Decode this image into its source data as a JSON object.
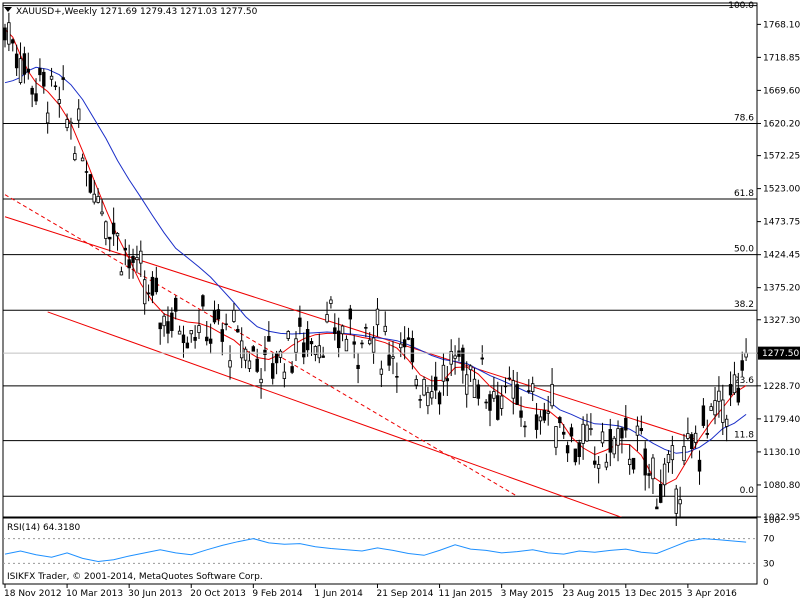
{
  "window": {
    "header": "XAUUSD+,Weekly  1271.69 1279.43 1271.03 1277.50",
    "footer": "ISIKFX Trader, © 2001-2014, MetaQuotes Software Corp.",
    "current_price_label": "1277.50"
  },
  "colors": {
    "candles": "#000000",
    "ma_fast": "#ee0000",
    "ma_slow": "#1a2ec8",
    "channel": "#ee0000",
    "fib_lines": "#000000",
    "rsi": "#1e90ff",
    "grid_border": "#000000"
  },
  "chart_data": [
    {
      "type": "candlestick",
      "title": "",
      "symbol": "XAUUSD+",
      "timeframe": "Weekly",
      "ohlc_last": {
        "open": 1271.69,
        "high": 1279.43,
        "low": 1271.03,
        "close": 1277.5
      },
      "ylim": [
        1032.95,
        1800
      ],
      "y_ticks": [
        1768.1,
        1718.85,
        1669.6,
        1620.2,
        1572.25,
        1523.0,
        1473.75,
        1424.45,
        1375.2,
        1327.3,
        1277.5,
        1228.7,
        1179.4,
        1130.1,
        1080.8,
        1032.95
      ],
      "y_tick_labels": [
        "1768.10",
        "1718.85",
        "1669.60",
        "1620.20",
        "1572.25",
        "1523.00",
        "1473.75",
        "1424.45",
        "1375.20",
        "1327.30",
        "1277.50",
        "1228.70",
        "1179.40",
        "1130.10",
        "1080.80",
        "1032.95"
      ],
      "x_tick_labels": [
        "18 Nov 2012",
        "10 Mar 2013",
        "30 Jun 2013",
        "20 Oct 2013",
        "9 Feb 2014",
        "1 Jun 2014",
        "21 Sep 2014",
        "11 Jan 2015",
        "3 May 2015",
        "23 Aug 2015",
        "13 Dec 2015",
        "3 Apr 2016"
      ],
      "fibonacci_levels": [
        {
          "label": "100.0",
          "price": 1796
        },
        {
          "label": "78.6",
          "price": 1620.2
        },
        {
          "label": "61.8",
          "price": 1507.5
        },
        {
          "label": "50.0",
          "price": 1424.45
        },
        {
          "label": "38.2",
          "price": 1341.5
        },
        {
          "label": "23.6",
          "price": 1228.7
        },
        {
          "label": "11.8",
          "price": 1147
        },
        {
          "label": "0.0",
          "price": 1064
        }
      ],
      "channel_lines": [
        {
          "style": "solid",
          "start": [
            "18 Nov 2012",
            1481
          ],
          "end": [
            "17 Apr 2016",
            1149
          ]
        },
        {
          "style": "solid",
          "start": [
            "3 Feb 2013",
            1339
          ],
          "end": [
            "3 Jan 2016",
            1024
          ]
        },
        {
          "style": "dashed",
          "start": [
            "18 Nov 2012",
            1514
          ],
          "end": [
            "31 May 2015",
            1064
          ]
        }
      ],
      "moving_averages": [
        {
          "color": "ma_fast",
          "points": [
            [
              0,
              1761
            ],
            [
              2,
              1749
            ],
            [
              4,
              1722
            ],
            [
              6,
              1698
            ],
            [
              8,
              1681
            ],
            [
              11,
              1668
            ],
            [
              14,
              1648
            ],
            [
              17,
              1620
            ],
            [
              20,
              1579
            ],
            [
              23,
              1535
            ],
            [
              26,
              1492
            ],
            [
              29,
              1452
            ],
            [
              32,
              1418
            ],
            [
              35,
              1381
            ],
            [
              38,
              1355
            ],
            [
              41,
              1336
            ],
            [
              44,
              1329
            ],
            [
              47,
              1324
            ],
            [
              50,
              1322
            ],
            [
              53,
              1316
            ],
            [
              56,
              1306
            ],
            [
              59,
              1297
            ],
            [
              62,
              1282
            ],
            [
              65,
              1271
            ],
            [
              68,
              1268
            ],
            [
              71,
              1276
            ],
            [
              74,
              1289
            ],
            [
              77,
              1299
            ],
            [
              80,
              1305
            ],
            [
              83,
              1307
            ],
            [
              86,
              1307
            ],
            [
              89,
              1305
            ],
            [
              92,
              1301
            ],
            [
              95,
              1298
            ],
            [
              98,
              1293
            ],
            [
              101,
              1285
            ],
            [
              104,
              1267
            ],
            [
              107,
              1245
            ],
            [
              110,
              1236
            ],
            [
              113,
              1237
            ],
            [
              116,
              1256
            ],
            [
              119,
              1257
            ],
            [
              122,
              1246
            ],
            [
              125,
              1228
            ],
            [
              128,
              1216
            ],
            [
              131,
              1203
            ],
            [
              134,
              1197
            ],
            [
              137,
              1194
            ],
            [
              140,
              1192
            ],
            [
              143,
              1178
            ],
            [
              146,
              1152
            ],
            [
              149,
              1136
            ],
            [
              152,
              1126
            ],
            [
              155,
              1133
            ],
            [
              158,
              1142
            ],
            [
              161,
              1141
            ],
            [
              164,
              1125
            ],
            [
              167,
              1093
            ],
            [
              170,
              1081
            ],
            [
              173,
              1090
            ],
            [
              176,
              1119
            ],
            [
              179,
              1150
            ],
            [
              182,
              1175
            ],
            [
              185,
              1196
            ],
            [
              188,
              1218
            ],
            [
              191,
              1229
            ]
          ]
        },
        {
          "color": "ma_slow",
          "points": [
            [
              0,
              1681
            ],
            [
              2,
              1684
            ],
            [
              4,
              1689
            ],
            [
              6,
              1699
            ],
            [
              8,
              1704
            ],
            [
              11,
              1701
            ],
            [
              14,
              1693
            ],
            [
              17,
              1678
            ],
            [
              20,
              1656
            ],
            [
              23,
              1627
            ],
            [
              26,
              1598
            ],
            [
              29,
              1565
            ],
            [
              32,
              1536
            ],
            [
              35,
              1510
            ],
            [
              38,
              1483
            ],
            [
              41,
              1457
            ],
            [
              44,
              1434
            ],
            [
              47,
              1420
            ],
            [
              50,
              1406
            ],
            [
              53,
              1391
            ],
            [
              56,
              1372
            ],
            [
              59,
              1353
            ],
            [
              62,
              1332
            ],
            [
              65,
              1317
            ],
            [
              68,
              1310
            ],
            [
              71,
              1307
            ],
            [
              74,
              1306
            ],
            [
              77,
              1307
            ],
            [
              80,
              1308
            ],
            [
              83,
              1309
            ],
            [
              86,
              1308
            ],
            [
              89,
              1306
            ],
            [
              92,
              1304
            ],
            [
              95,
              1301
            ],
            [
              98,
              1299
            ],
            [
              101,
              1296
            ],
            [
              104,
              1290
            ],
            [
              107,
              1282
            ],
            [
              110,
              1274
            ],
            [
              113,
              1268
            ],
            [
              116,
              1265
            ],
            [
              119,
              1262
            ],
            [
              122,
              1253
            ],
            [
              125,
              1244
            ],
            [
              128,
              1237
            ],
            [
              131,
              1229
            ],
            [
              134,
              1221
            ],
            [
              137,
              1214
            ],
            [
              140,
              1206
            ],
            [
              143,
              1193
            ],
            [
              146,
              1186
            ],
            [
              149,
              1178
            ],
            [
              152,
              1172
            ],
            [
              155,
              1171
            ],
            [
              158,
              1169
            ],
            [
              161,
              1164
            ],
            [
              164,
              1154
            ],
            [
              167,
              1143
            ],
            [
              170,
              1134
            ],
            [
              173,
              1128
            ],
            [
              176,
              1130
            ],
            [
              179,
              1137
            ],
            [
              182,
              1149
            ],
            [
              185,
              1165
            ],
            [
              188,
              1173
            ],
            [
              191,
              1186
            ]
          ]
        }
      ]
    },
    {
      "type": "line",
      "title": "RSI(14) 64.3180",
      "ylim": [
        0,
        100
      ],
      "y_tick_labels": [
        "100",
        "70",
        "30",
        "0"
      ],
      "levels": [
        70,
        30
      ],
      "series": [
        {
          "name": "RSI(14)",
          "values": [
            [
              0,
              45
            ],
            [
              4,
              50
            ],
            [
              8,
              44
            ],
            [
              12,
              40
            ],
            [
              16,
              47
            ],
            [
              20,
              38
            ],
            [
              24,
              33
            ],
            [
              28,
              36
            ],
            [
              32,
              42
            ],
            [
              36,
              47
            ],
            [
              40,
              52
            ],
            [
              44,
              47
            ],
            [
              48,
              44
            ],
            [
              52,
              52
            ],
            [
              56,
              59
            ],
            [
              60,
              65
            ],
            [
              64,
              70
            ],
            [
              68,
              63
            ],
            [
              72,
              61
            ],
            [
              76,
              62
            ],
            [
              80,
              57
            ],
            [
              84,
              54
            ],
            [
              88,
              52
            ],
            [
              92,
              50
            ],
            [
              96,
              55
            ],
            [
              100,
              51
            ],
            [
              104,
              46
            ],
            [
              108,
              43
            ],
            [
              112,
              51
            ],
            [
              116,
              60
            ],
            [
              120,
              53
            ],
            [
              124,
              51
            ],
            [
              128,
              47
            ],
            [
              132,
              49
            ],
            [
              136,
              52
            ],
            [
              140,
              47
            ],
            [
              144,
              45
            ],
            [
              148,
              50
            ],
            [
              152,
              48
            ],
            [
              156,
              51
            ],
            [
              160,
              53
            ],
            [
              164,
              48
            ],
            [
              168,
              46
            ],
            [
              172,
              56
            ],
            [
              176,
              66
            ],
            [
              180,
              70
            ],
            [
              184,
              68
            ],
            [
              188,
              66
            ],
            [
              191,
              64.3
            ]
          ]
        }
      ]
    }
  ]
}
